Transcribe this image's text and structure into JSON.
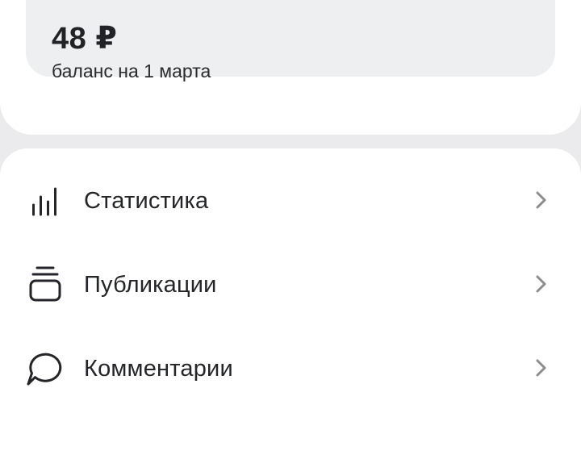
{
  "balance": {
    "amount": "48 ₽",
    "caption": "баланс на 1 марта"
  },
  "menu": {
    "items": [
      {
        "label": "Статистика",
        "icon": "bar-chart-icon"
      },
      {
        "label": "Публикации",
        "icon": "stack-icon"
      },
      {
        "label": "Комментарии",
        "icon": "comment-bubble-icon"
      }
    ]
  },
  "colors": {
    "background": "#ebebed",
    "card": "#ffffff",
    "balance_box": "#eeeff1",
    "text": "#242528",
    "chevron": "#8c8d91"
  }
}
